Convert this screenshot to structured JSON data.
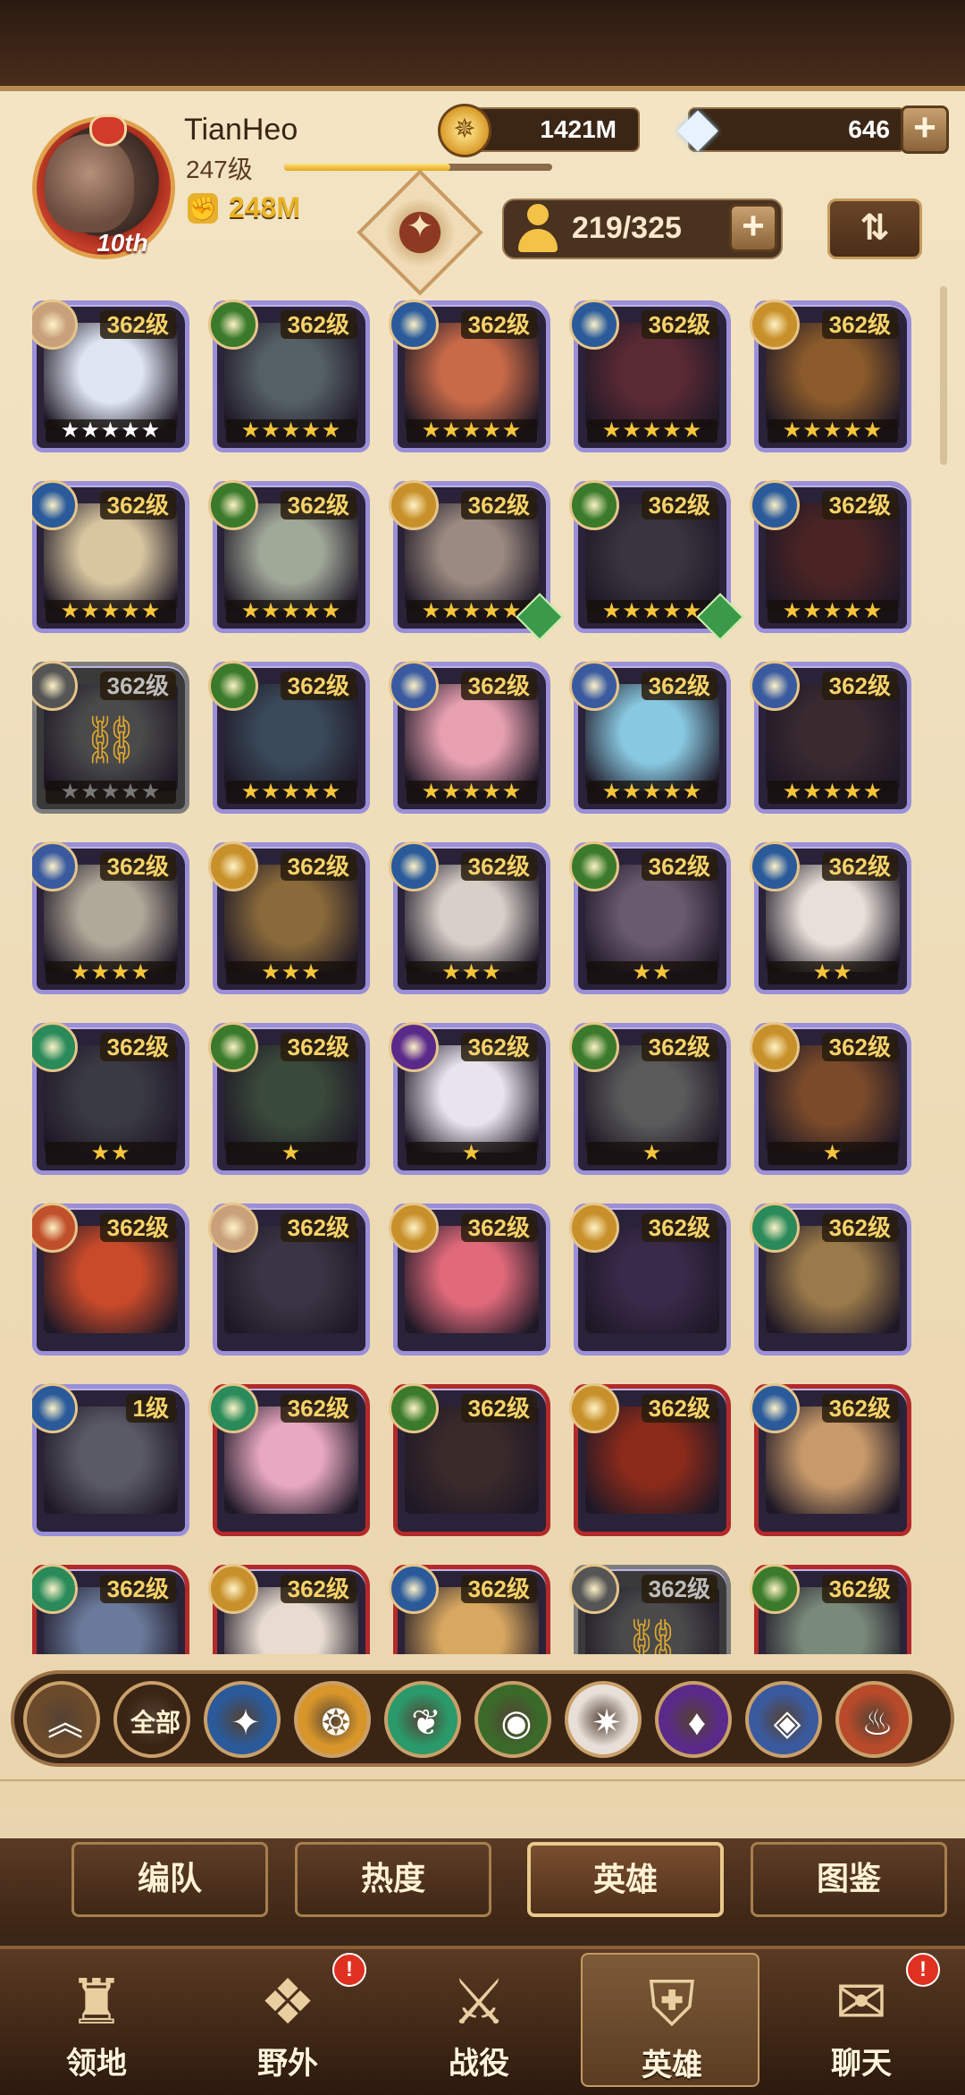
{
  "player": {
    "name": "TianHeo",
    "level": "247级",
    "rank_badge": "10th",
    "power": "248M",
    "xp_fraction": 0.62
  },
  "resources": {
    "gold": "1421M",
    "gems": "646",
    "plus": "+"
  },
  "roster": {
    "count": "219/325",
    "plus": "+"
  },
  "heroes": [
    {
      "level": "362级",
      "stars": "★★★★★",
      "star_color": "white",
      "border": "purple",
      "faction": "#c8a07a",
      "portrait": "#dfe6f2"
    },
    {
      "level": "362级",
      "stars": "★★★★★",
      "star_color": "gold",
      "border": "purple",
      "faction": "#3a7a2a",
      "portrait": "#556066"
    },
    {
      "level": "362级",
      "stars": "★★★★★",
      "star_color": "gold",
      "border": "purple",
      "faction": "#2a5a9a",
      "portrait": "#c86a48"
    },
    {
      "level": "362级",
      "stars": "★★★★★",
      "star_color": "gold",
      "border": "purple",
      "faction": "#2a5a9a",
      "portrait": "#5a2a34"
    },
    {
      "level": "362级",
      "stars": "★★★★★",
      "star_color": "gold",
      "border": "purple",
      "faction": "#c8902a",
      "portrait": "#8a5a2a"
    },
    {
      "level": "362级",
      "stars": "★★★★★",
      "star_color": "gold",
      "border": "purple",
      "faction": "#2a5a9a",
      "portrait": "#d8c6a0"
    },
    {
      "level": "362级",
      "stars": "★★★★★",
      "star_color": "gold",
      "border": "purple",
      "faction": "#3a7a2a",
      "portrait": "#a0a898"
    },
    {
      "level": "362级",
      "stars": "★★★★★",
      "star_color": "gold",
      "border": "purple",
      "faction": "#c8902a",
      "portrait": "#9a8a80",
      "hourglass": true
    },
    {
      "level": "362级",
      "stars": "★★★★★",
      "star_color": "gold",
      "border": "purple",
      "faction": "#3a7a2a",
      "portrait": "#3a3440",
      "hourglass": true
    },
    {
      "level": "362级",
      "stars": "★★★★★",
      "star_color": "gold",
      "border": "purple",
      "faction": "#2a5a9a",
      "portrait": "#4a2424"
    },
    {
      "level": "362级",
      "stars": "★★★★★",
      "star_color": "gray",
      "border": "gray",
      "faction": "#555555",
      "portrait": "#4a4a4a",
      "locked": true
    },
    {
      "level": "362级",
      "stars": "★★★★★",
      "star_color": "gold",
      "border": "purple",
      "faction": "#3a7a2a",
      "portrait": "#3a4a5a"
    },
    {
      "level": "362级",
      "stars": "★★★★★",
      "star_color": "gold",
      "border": "purple",
      "faction": "#3a5aa0",
      "portrait": "#e6a0b0"
    },
    {
      "level": "362级",
      "stars": "★★★★★",
      "star_color": "gold",
      "border": "purple",
      "faction": "#3a5aa0",
      "portrait": "#88c8e0"
    },
    {
      "level": "362级",
      "stars": "★★★★★",
      "star_color": "gold",
      "border": "purple",
      "faction": "#3a5aa0",
      "portrait": "#3a2a30"
    },
    {
      "level": "362级",
      "stars": "★★★★",
      "star_color": "gold",
      "border": "purple",
      "faction": "#3a5aa0",
      "portrait": "#b0a898"
    },
    {
      "level": "362级",
      "stars": "★★★",
      "star_color": "gold",
      "border": "purple",
      "faction": "#c8902a",
      "portrait": "#8a6a3a"
    },
    {
      "level": "362级",
      "stars": "★★★",
      "star_color": "gold",
      "border": "purple",
      "faction": "#2a5a9a",
      "portrait": "#d8d0c8"
    },
    {
      "level": "362级",
      "stars": "★★",
      "star_color": "gold",
      "border": "purple",
      "faction": "#3a7a2a",
      "portrait": "#6a5a70"
    },
    {
      "level": "362级",
      "stars": "★★",
      "star_color": "gold",
      "border": "purple",
      "faction": "#2a5a9a",
      "portrait": "#e8e0d8"
    },
    {
      "level": "362级",
      "stars": "★★",
      "star_color": "gold",
      "border": "purple",
      "faction": "#2a8a5a",
      "portrait": "#3a3a44"
    },
    {
      "level": "362级",
      "stars": "★",
      "star_color": "gold",
      "border": "purple",
      "faction": "#3a7a2a",
      "portrait": "#3a4a3a"
    },
    {
      "level": "362级",
      "stars": "★",
      "star_color": "gold",
      "border": "purple",
      "faction": "#5a2a8a",
      "portrait": "#e8e4ee"
    },
    {
      "level": "362级",
      "stars": "★",
      "star_color": "gold",
      "border": "purple",
      "faction": "#3a7a2a",
      "portrait": "#5a5a5a"
    },
    {
      "level": "362级",
      "stars": "★",
      "star_color": "gold",
      "border": "purple",
      "faction": "#c8902a",
      "portrait": "#7a4a2a"
    },
    {
      "level": "362级",
      "stars": "",
      "star_color": "gold",
      "border": "purple",
      "faction": "#c0502a",
      "portrait": "#c84a2a"
    },
    {
      "level": "362级",
      "stars": "",
      "star_color": "gold",
      "border": "purple",
      "faction": "#c8a07a",
      "portrait": "#3a3444"
    },
    {
      "level": "362级",
      "stars": "",
      "star_color": "gold",
      "border": "purple",
      "faction": "#c8902a",
      "portrait": "#e06a7a"
    },
    {
      "level": "362级",
      "stars": "",
      "star_color": "gold",
      "border": "purple",
      "faction": "#c8902a",
      "portrait": "#3a2a4a"
    },
    {
      "level": "362级",
      "stars": "",
      "star_color": "gold",
      "border": "purple",
      "faction": "#2a8a5a",
      "portrait": "#9a7a4a"
    },
    {
      "level": "1级",
      "stars": "",
      "star_color": "gold",
      "border": "purple",
      "faction": "#2a5a9a",
      "portrait": "#5a5a66"
    },
    {
      "level": "362级",
      "stars": "",
      "star_color": "gold",
      "border": "red",
      "faction": "#2a8a5a",
      "portrait": "#e8a8c0"
    },
    {
      "level": "362级",
      "stars": "",
      "star_color": "gold",
      "border": "red",
      "faction": "#3a7a2a",
      "portrait": "#3a2a2a"
    },
    {
      "level": "362级",
      "stars": "",
      "star_color": "gold",
      "border": "red",
      "faction": "#c8902a",
      "portrait": "#8a2a1a"
    },
    {
      "level": "362级",
      "stars": "",
      "star_color": "gold",
      "border": "red",
      "faction": "#2a5a9a",
      "portrait": "#c89a6a"
    },
    {
      "level": "362级",
      "stars": "",
      "star_color": "gold",
      "border": "red",
      "faction": "#2a8a5a",
      "portrait": "#6a7a9a"
    },
    {
      "level": "362级",
      "stars": "",
      "star_color": "gold",
      "border": "red",
      "faction": "#c8902a",
      "portrait": "#e8dcd0"
    },
    {
      "level": "362级",
      "stars": "",
      "star_color": "gold",
      "border": "red",
      "faction": "#2a5a9a",
      "portrait": "#d8a860"
    },
    {
      "level": "362级",
      "stars": "",
      "star_color": "gray",
      "border": "gray",
      "faction": "#555555",
      "portrait": "#4a4a4a",
      "locked": true
    },
    {
      "level": "362级",
      "stars": "",
      "star_color": "gold",
      "border": "red",
      "faction": "#3a7a2a",
      "portrait": "#7a8a7a"
    }
  ],
  "filters": [
    {
      "name": "filter-up-button",
      "label": "",
      "glyph": "︽",
      "bg": "#6a4a2a"
    },
    {
      "name": "filter-all-button",
      "label": "全部",
      "glyph": "",
      "bg": "#3a2414"
    },
    {
      "name": "filter-lightbearer-button",
      "label": "",
      "glyph": "✦",
      "bg": "#2a5a9a"
    },
    {
      "name": "filter-mauler-button",
      "label": "",
      "glyph": "❂",
      "bg": "#d8962a"
    },
    {
      "name": "filter-wilder-button",
      "label": "",
      "glyph": "❦",
      "bg": "#2a9a6a"
    },
    {
      "name": "filter-graveborn-button",
      "label": "",
      "glyph": "◉",
      "bg": "#3a6a2a"
    },
    {
      "name": "filter-celestial-button",
      "label": "",
      "glyph": "✷",
      "bg": "#e8e0d8"
    },
    {
      "name": "filter-hypogean-button",
      "label": "",
      "glyph": "♦",
      "bg": "#5a2a8a"
    },
    {
      "name": "filter-dimensional-button",
      "label": "",
      "glyph": "◈",
      "bg": "#3a5aa0"
    },
    {
      "name": "filter-draconis-button",
      "label": "",
      "glyph": "♨",
      "bg": "#b84a2a"
    }
  ],
  "subtabs": [
    "编队",
    "热度",
    "英雄",
    "图鉴"
  ],
  "active_subtab": 2,
  "nav": [
    {
      "label": "领地",
      "glyph": "♜",
      "notif": false
    },
    {
      "label": "野外",
      "glyph": "❖",
      "notif": true
    },
    {
      "label": "战役",
      "glyph": "⚔",
      "notif": false
    },
    {
      "label": "英雄",
      "glyph": "⛨",
      "notif": false,
      "active": true
    },
    {
      "label": "聊天",
      "glyph": "✉",
      "notif": true
    }
  ],
  "notif_mark": "!",
  "sort_glyph": "⇅"
}
